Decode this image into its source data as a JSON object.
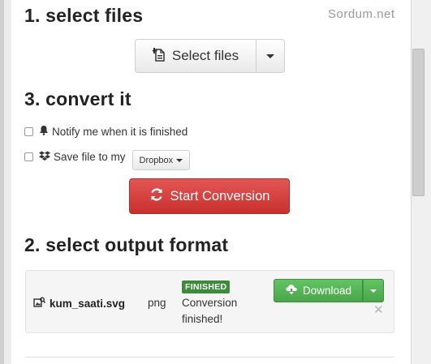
{
  "watermark": "Sordum.net",
  "section_select": {
    "heading": "1. select files",
    "button_label": "Select files"
  },
  "section_convert": {
    "heading": "3. convert it",
    "notify_label": "Notify me when it is finished",
    "save_label": "Save file to my",
    "storage_option": "Dropbox",
    "start_button": "Start Conversion"
  },
  "section_output": {
    "heading": "2. select output format"
  },
  "file": {
    "name": "kum_saati.svg",
    "format": "png",
    "badge": "FINISHED",
    "status": "Conversion finished!",
    "download_label": "Download"
  },
  "colors": {
    "danger": "#d9534f",
    "success": "#5cb85c",
    "badge": "#3c8c3c"
  },
  "icons": [
    "add-file-icon",
    "bell-icon",
    "dropbox-icon",
    "refresh-icon",
    "image-file-icon",
    "cloud-download-icon",
    "close-icon"
  ]
}
